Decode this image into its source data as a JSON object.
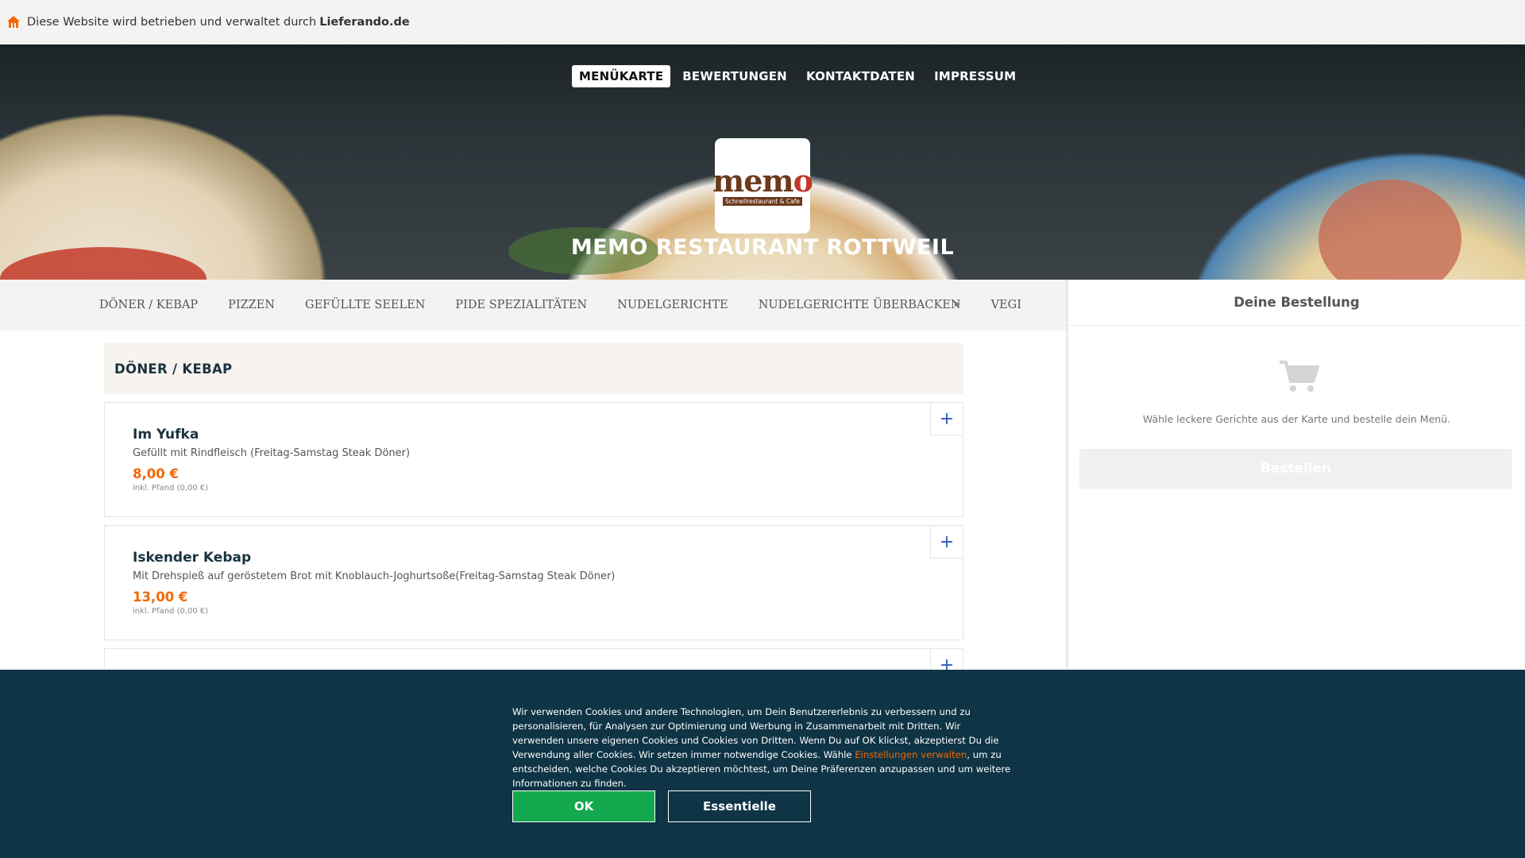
{
  "topbar": {
    "text": "Diese Website wird betrieben und verwaltet durch",
    "brand": "Lieferando.de"
  },
  "nav": {
    "items": [
      {
        "label": "MENÜKARTE",
        "active": true
      },
      {
        "label": "BEWERTUNGEN"
      },
      {
        "label": "KONTAKTDATEN"
      },
      {
        "label": "IMPRESSUM"
      }
    ]
  },
  "logo": {
    "word_left": "mem",
    "word_right": "o",
    "sub": "Schnellrestaurant & Cafe"
  },
  "restaurant": {
    "name": "MEMO RESTAURANT ROTTWEIL"
  },
  "categories": [
    "DÖNER / KEBAP",
    "PIZZEN",
    "GEFÜLLTE SEELEN",
    "PIDE SPEZIALITÄTEN",
    "NUDELGERICHTE",
    "NUDELGERICHTE ÜBERBACKEN",
    "VEGI"
  ],
  "section": {
    "title": "DÖNER / KEBAP"
  },
  "products": [
    {
      "name": "Im Yufka",
      "desc": "Gefüllt mit Rindfleisch (Freitag-Samstag Steak Döner)",
      "price": "8,00 €",
      "pfand": "inkl. Pfand (0,00 €)"
    },
    {
      "name": "Iskender Kebap",
      "desc": "Mit Drehspieß auf geröstetem Brot mit Knoblauch-Joghurtsoße(Freitag-Samstag Steak Döner)",
      "price": "13,00 €",
      "pfand": "inkl. Pfand (0,00 €)"
    }
  ],
  "plus_label": "+",
  "basket": {
    "title": "Deine Bestellung",
    "hint": "Wähle leckere Gerichte aus der Karte und bestelle dein Menü.",
    "order_button": "Bestellen"
  },
  "cookie": {
    "text_before": "Wir verwenden Cookies und andere Technologien, um Dein Benutzererlebnis zu verbessern und zu personalisieren, für Analysen zur Optimierung und Werbung in Zusammenarbeit mit Dritten. Wir verwenden unsere eigenen Cookies und Cookies von Dritten. Wenn Du auf OK klickst, akzeptierst Du die Verwendung aller Cookies. Wir setzen immer notwendige Cookies. Wähle ",
    "link": "Einstellungen verwalten",
    "text_after": ", um zu entscheiden, welche Cookies Du akzeptieren möchtest, um Deine Präferenzen anzupassen und um weitere Informationen zu finden.",
    "ok": "OK",
    "essential": "Essentielle"
  },
  "colors": {
    "accent": "#f36805",
    "ok_green": "#13a84d",
    "cookie_bg": "#0e3445",
    "heading": "#1a3340"
  }
}
